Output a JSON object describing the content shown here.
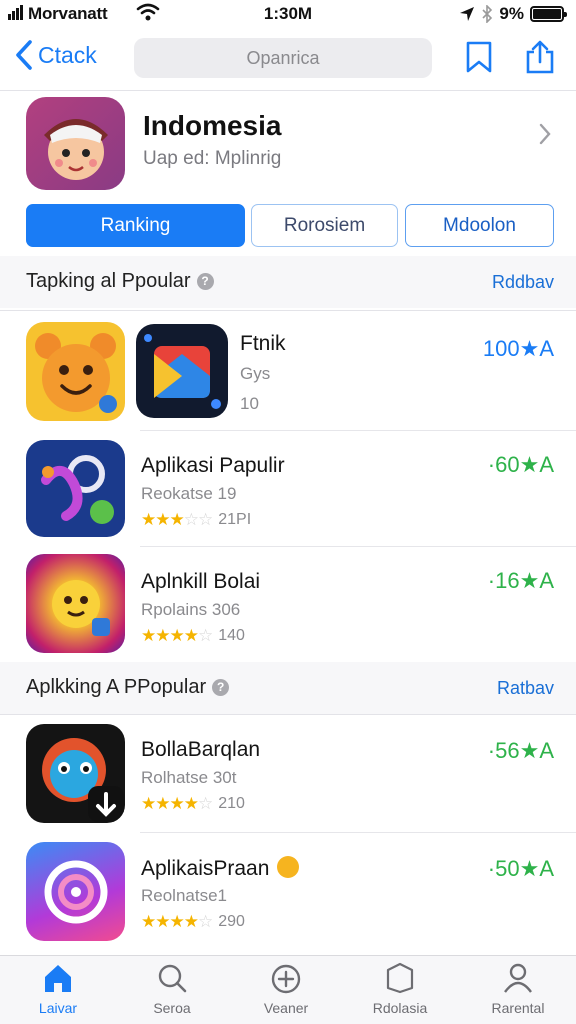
{
  "status_bar": {
    "carrier": "Morvanatt",
    "time": "1:30M",
    "battery": "9%"
  },
  "nav": {
    "back_label": "Ctack",
    "search_placeholder": "Opanrica"
  },
  "header": {
    "title": "Indomesia",
    "subtitle": "Uap ed: Mplinrig"
  },
  "segments": [
    {
      "label": "Ranking",
      "active": true
    },
    {
      "label": "Rorosiem",
      "active": false
    },
    {
      "label": "Mdoolon",
      "active": false
    }
  ],
  "sections": [
    {
      "title": "Tapking al Ppoular",
      "link": "Rddbav",
      "apps": [
        {
          "name": "Ftnik",
          "sub": "Gys",
          "rating_text": "10",
          "count": "100★A",
          "count_color": "#1a7cf5"
        },
        {
          "name": "Aplikasi Papulir",
          "sub": "Reokatse 19",
          "stars": 3,
          "rating_text": "21PI",
          "count": "·60★A",
          "count_color": "#2eb24a"
        },
        {
          "name": "Aplnkill Bolai",
          "sub": "Rpolains 306",
          "stars": 4,
          "rating_text": "140",
          "count": "·16★A",
          "count_color": "#2eb24a"
        }
      ]
    },
    {
      "title": "Aplkking A PPopular",
      "link": "Ratbav",
      "apps": [
        {
          "name": "BollaBarqlan",
          "sub": "Rolhatse 30t",
          "stars": 4,
          "rating_text": "210",
          "count": "·56★A",
          "count_color": "#2eb24a"
        },
        {
          "name": "AplikaisPraan",
          "sub": "Reolnatse1",
          "stars": 4,
          "rating_text": "290",
          "count": "·50★A",
          "count_color": "#2eb24a"
        }
      ]
    }
  ],
  "tabs": [
    {
      "label": "Laivar",
      "icon": "home-icon",
      "active": true
    },
    {
      "label": "Seroa",
      "icon": "search-icon",
      "active": false
    },
    {
      "label": "Veaner",
      "icon": "plus-icon",
      "active": false
    },
    {
      "label": "Rdolasia",
      "icon": "box-icon",
      "active": false
    },
    {
      "label": "Rarental",
      "icon": "person-icon",
      "active": false
    }
  ]
}
